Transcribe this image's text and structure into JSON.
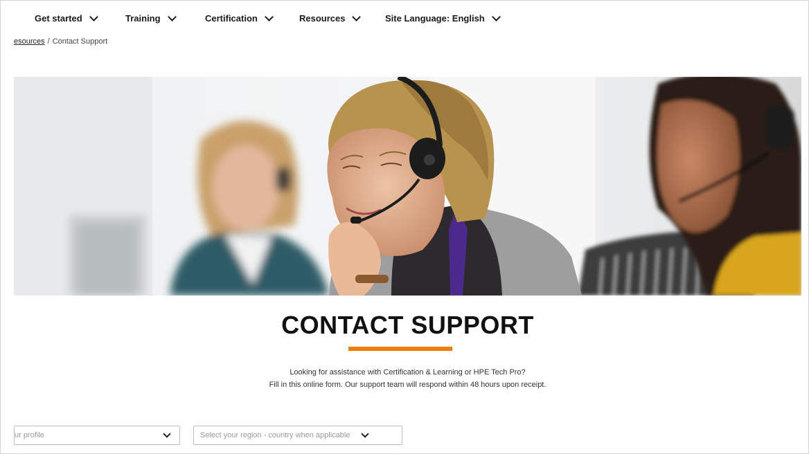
{
  "nav": {
    "items": [
      {
        "label": "Get started"
      },
      {
        "label": "Training"
      },
      {
        "label": "Certification"
      },
      {
        "label": "Resources"
      },
      {
        "label": "Site Language: English"
      }
    ]
  },
  "breadcrumb": {
    "parent": "esources",
    "separator": "/",
    "current": "Contact Support"
  },
  "main": {
    "title": "CONTACT SUPPORT",
    "intro_line1": "Looking for assistance with Certification & Learning or HPE Tech Pro?",
    "intro_line2": "Fill in this online form. Our support team will respond within 48 hours upon receipt."
  },
  "form": {
    "profile_placeholder": "ur profile",
    "region_placeholder": "Select your region - country when applicable"
  },
  "colors": {
    "accent": "#f07c00",
    "headset": "#1c1c1c",
    "purple_trim": "#4b2a8c"
  }
}
